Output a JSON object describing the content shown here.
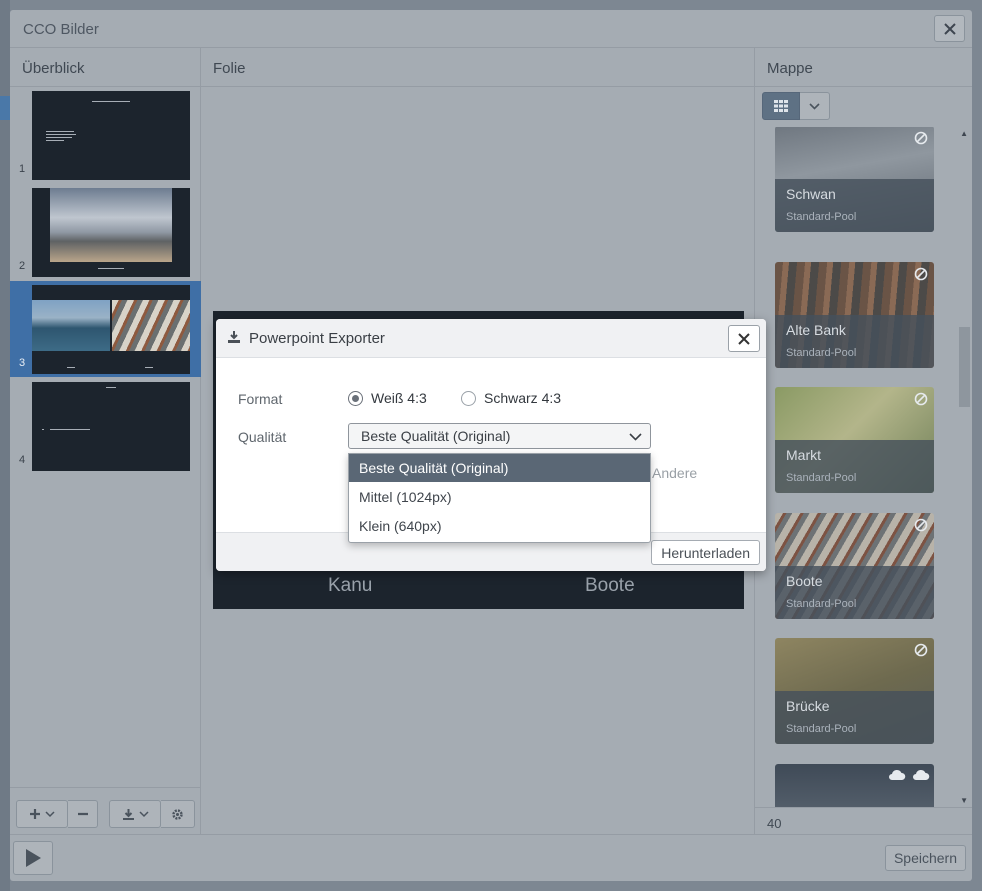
{
  "window": {
    "title": "CCO Bilder"
  },
  "columns": {
    "overview": "Überblick",
    "slide": "Folie",
    "folder": "Mappe"
  },
  "slides": [
    {
      "number": "1",
      "type": "text"
    },
    {
      "number": "2",
      "type": "image"
    },
    {
      "number": "3",
      "type": "two-images",
      "selected": true
    },
    {
      "number": "4",
      "type": "text"
    }
  ],
  "slide_canvas": {
    "label_left": "Kanu",
    "label_right": "Boote"
  },
  "folder": {
    "images": [
      {
        "name": "Schwan",
        "pool": "Standard-Pool"
      },
      {
        "name": "Alte Bank",
        "pool": "Standard-Pool"
      },
      {
        "name": "Markt",
        "pool": "Standard-Pool"
      },
      {
        "name": "Boote",
        "pool": "Standard-Pool"
      },
      {
        "name": "Brücke",
        "pool": "Standard-Pool"
      }
    ],
    "count": "40"
  },
  "footer": {
    "save_label": "Speichern"
  },
  "modal": {
    "title": "Powerpoint Exporter",
    "format_label": "Format",
    "format_options": [
      "Weiß 4:3",
      "Schwarz 4:3"
    ],
    "format_selected": "Weiß 4:3",
    "quality_label": "Qualität",
    "quality_value": "Beste Qualität (Original)",
    "quality_options": [
      "Beste Qualität (Original)",
      "Mittel (1024px)",
      "Klein (640px)"
    ],
    "other_text": "Andere",
    "download_label": "Herunterladen"
  },
  "colors": {
    "accent_selected": "#3f6fa6",
    "dropdown_highlight": "#5a6775"
  }
}
